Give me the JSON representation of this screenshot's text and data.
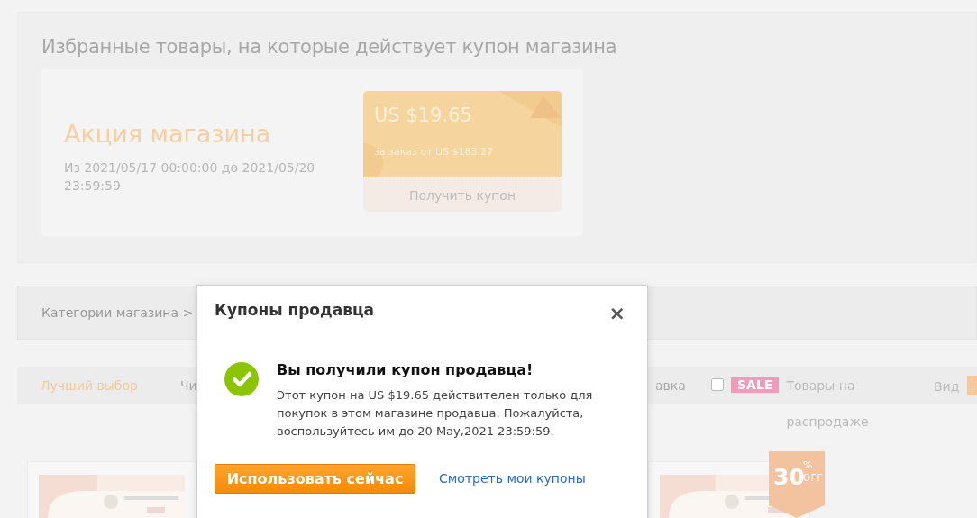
{
  "featured": {
    "title": "Избранные товары, на которые действует купон магазина",
    "promo": {
      "title": "Акция магазина",
      "dates": "Из 2021/05/17 00:00:00 до 2021/05/20 23:59:59"
    },
    "coupon": {
      "amount": "US $19.65",
      "condition": "за заказ от US $183.27",
      "button": "Получить купон"
    }
  },
  "categories": {
    "label": "Категории магазина >"
  },
  "sort_bar": {
    "options": [
      {
        "label": "Лучший выбор",
        "selected": true
      },
      {
        "label": "Чи",
        "selected": false
      },
      {
        "label": "авка",
        "selected": false
      }
    ],
    "sale_filter": {
      "checked": false,
      "badge": "SALE",
      "label": "Товары на распродаже"
    },
    "view_label": "Вид"
  },
  "products": [
    {
      "kind": "picture"
    },
    {
      "kind": "picture",
      "discount": {
        "value": "30",
        "percent": "%",
        "off": "OFF"
      }
    }
  ],
  "dialog": {
    "title": "Купоны продавца",
    "close": "×",
    "heading": "Вы получили купон продавца!",
    "message": "Этот купон на US $19.65 действителен только для покупок в этом магазине продавца. Пожалуйста, воспользуйтесь им до 20 May,2021 23:59:59.",
    "primary_button": "Использовать сейчас",
    "link": "Смотреть мои купоны"
  }
}
